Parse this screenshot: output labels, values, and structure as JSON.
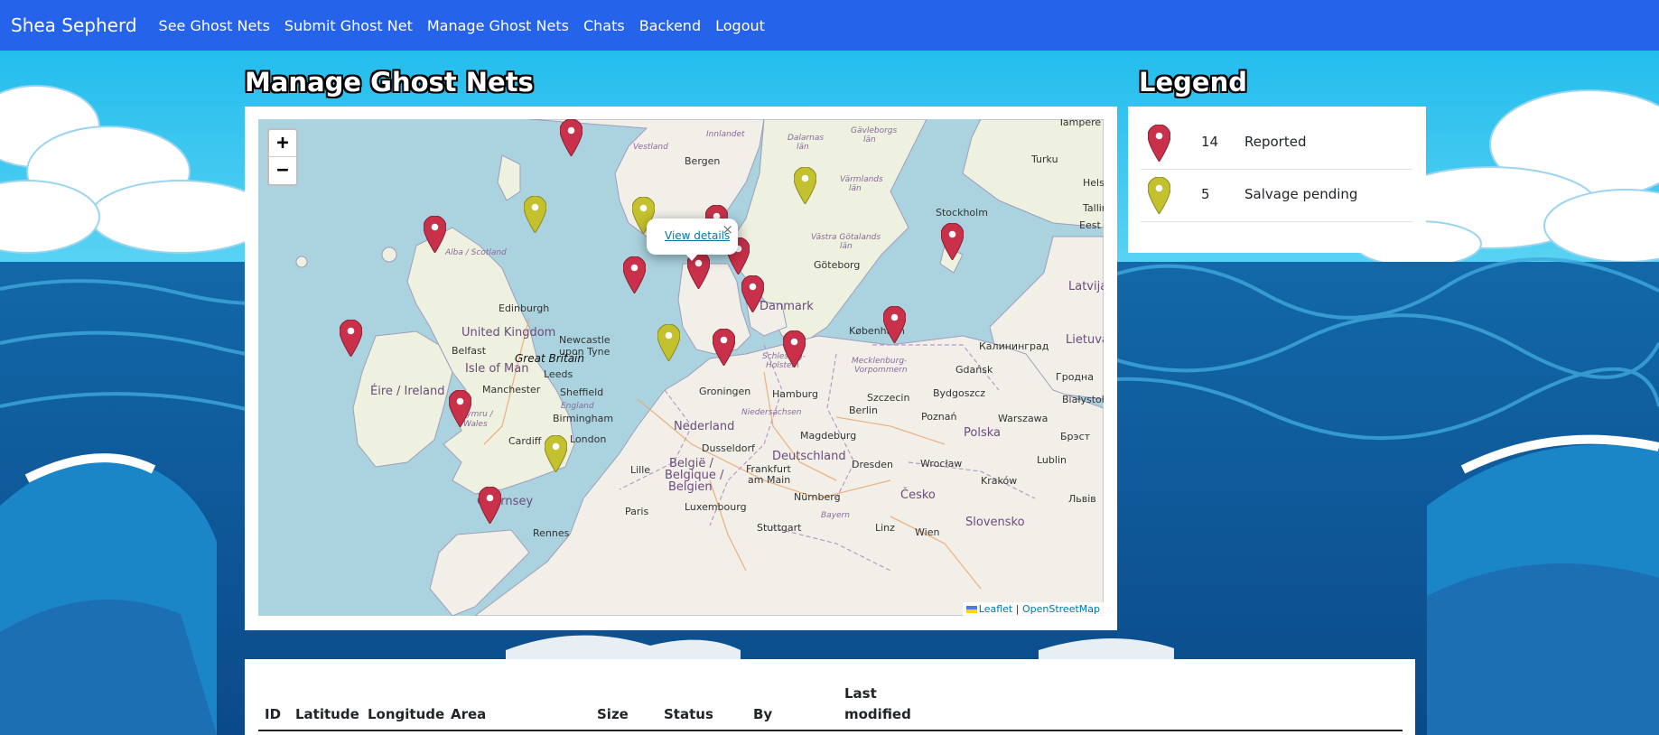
{
  "navbar": {
    "brand": "Shea Sepherd",
    "links": [
      "See Ghost Nets",
      "Submit Ghost Net",
      "Manage Ghost Nets",
      "Chats",
      "Backend",
      "Logout"
    ]
  },
  "page_title": "Manage Ghost Nets",
  "legend": {
    "title": "Legend",
    "items": [
      {
        "count": "14",
        "label": "Reported",
        "color": "#c9304a"
      },
      {
        "count": "5",
        "label": "Salvage pending",
        "color": "#c4c12e"
      }
    ]
  },
  "map": {
    "zoom_in": "+",
    "zoom_out": "−",
    "popup": {
      "link": "View details",
      "close": "×"
    },
    "attribution": {
      "leaflet": "Leaflet",
      "separator": "|",
      "osm": "OpenStreetMap"
    },
    "labels": {
      "vestland": "Vestland",
      "innlandet": "Innlandet",
      "dalarnas": "Dalarnas",
      "lan1": "län",
      "gavleborgs": "Gävleborgs",
      "lan2": "län",
      "tampere": "Tampere",
      "bergen": "Bergen",
      "turku": "Turku",
      "varmlands": "Värmlands",
      "lan3": "län",
      "hels": "Hels",
      "stockholm": "Stockholm",
      "tallin": "Tallin",
      "eest": "Eest",
      "alba": "Alba / Scotland",
      "vastra": "Västra Götalands",
      "lan4": "län",
      "goteborg": "Göteborg",
      "latvija": "Latvija",
      "edinburgh": "Edinburgh",
      "danmark": "Danmark",
      "kobenhavn": "København",
      "lietuva": "Lietuva",
      "uk": "United Kingdom",
      "newcastle": "Newcastle",
      "upon_tyne": "upon Tyne",
      "belfast": "Belfast",
      "great_britain": "Great Britain",
      "isle_of_man": "Isle of Man",
      "kaliningrad": "Калининград",
      "leeds": "Leeds",
      "schleswig": "Schleswig-",
      "holstein": "Holstein",
      "mecklenburg": "Mecklenburg-",
      "vorpommern": "Vorpommern",
      "gdansk": "Gdańsk",
      "eire": "Éire / Ireland",
      "manchester": "Manchester",
      "sheffield": "Sheffield",
      "groningen": "Groningen",
      "hamburg": "Hamburg",
      "szczecin": "Szczecin",
      "bydgoszcz": "Bydgoszcz",
      "grodno": "Гродна",
      "bialystok": "Białystok",
      "cymru": "Cymru /",
      "wales": "Wales",
      "england": "England",
      "birmingham": "Birmingham",
      "niedersachsen": "Niedersachsen",
      "berlin": "Berlin",
      "poznan": "Poznań",
      "warszawa": "Warszawa",
      "nederland": "Nederland",
      "cardiff": "Cardiff",
      "london": "London",
      "polska": "Polska",
      "brest": "Брэст",
      "magdeburg": "Magdeburg",
      "dusseldorf": "Dusseldorf",
      "deutschland": "Deutschland",
      "belgie": "België /",
      "belgique": "Belgique /",
      "belgien": "Belgien",
      "lille": "Lille",
      "frankfurt": "Frankfurt",
      "am_main": "am Main",
      "dresden": "Dresden",
      "wroclaw": "Wrocław",
      "lublin": "Lublin",
      "krakow": "Kraków",
      "guernsey": "Guernsey",
      "cesko": "Česko",
      "paris": "Paris",
      "luxembourg": "Luxembourg",
      "nurnberg": "Nürnberg",
      "lviv": "Львів",
      "bayern": "Bayern",
      "rennes": "Rennes",
      "stuttgart": "Stuttgart",
      "linz": "Linz",
      "wien": "Wien",
      "slovensko": "Slovensko"
    }
  },
  "table": {
    "headers": [
      "ID",
      "Latitude",
      "Longitude",
      "Area",
      "Size",
      "Status",
      "By",
      "Last",
      "modified"
    ]
  }
}
